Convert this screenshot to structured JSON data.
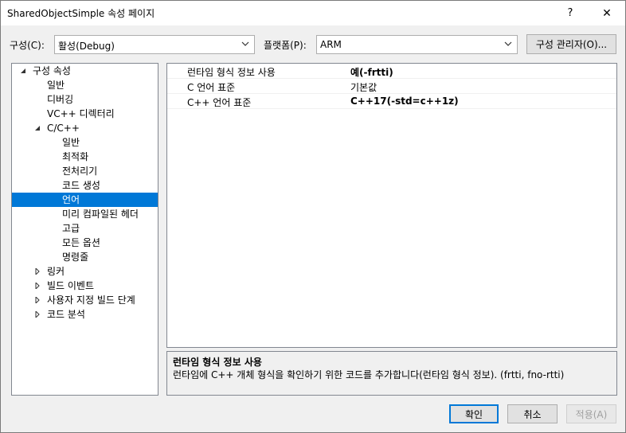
{
  "window": {
    "title": "SharedObjectSimple 속성 페이지",
    "help_label": "?",
    "close_label": "✕"
  },
  "toolbar": {
    "config_label": "구성(C):",
    "config_value": "활성(Debug)",
    "platform_label": "플랫폼(P):",
    "platform_value": "ARM",
    "config_manager_label": "구성 관리자(O)..."
  },
  "tree": {
    "items": [
      {
        "label": "구성 속성",
        "expander": "expanded"
      },
      {
        "label": "일반"
      },
      {
        "label": "디버깅"
      },
      {
        "label": "VC++ 디렉터리"
      },
      {
        "label": "C/C++",
        "expander": "expanded"
      },
      {
        "label": "일반"
      },
      {
        "label": "최적화"
      },
      {
        "label": "전처리기"
      },
      {
        "label": "코드 생성"
      },
      {
        "label": "언어",
        "selected": true
      },
      {
        "label": "미리 컴파일된 헤더"
      },
      {
        "label": "고급"
      },
      {
        "label": "모든 옵션"
      },
      {
        "label": "명령줄"
      },
      {
        "label": "링커",
        "expander": "collapsed"
      },
      {
        "label": "빌드 이벤트",
        "expander": "collapsed"
      },
      {
        "label": "사용자 지정 빌드 단계",
        "expander": "collapsed"
      },
      {
        "label": "코드 분석",
        "expander": "collapsed"
      }
    ]
  },
  "properties": [
    {
      "name": "런타임 형식 정보 사용",
      "value": "예(-frtti)",
      "bold": true
    },
    {
      "name": "C 언어 표준",
      "value": "기본값",
      "bold": false
    },
    {
      "name": "C++ 언어 표준",
      "value": "C++17(-std=c++1z)",
      "bold": true
    }
  ],
  "description": {
    "title": "런타임 형식 정보 사용",
    "text": "런타임에 C++ 개체 형식을 확인하기 위한 코드를 추가합니다(런타임 형식 정보).     (frtti, fno-rtti)"
  },
  "buttons": {
    "ok": "확인",
    "cancel": "취소",
    "apply": "적용(A)"
  },
  "colors": {
    "selection": "#0078d7",
    "dialog_bg": "#f0f0f0"
  }
}
